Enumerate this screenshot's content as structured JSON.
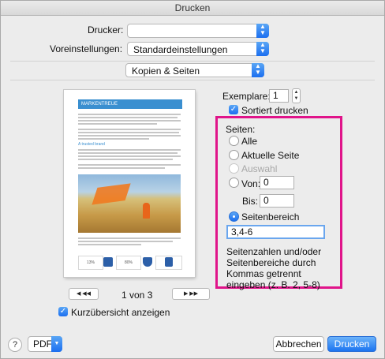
{
  "window": {
    "title": "Drucken"
  },
  "printer": {
    "label": "Drucker:",
    "value": ""
  },
  "presets": {
    "label": "Voreinstellungen:",
    "value": "Standardeinstellungen"
  },
  "section_menu": {
    "value": "Kopien & Seiten"
  },
  "copies": {
    "label": "Exemplare:",
    "value": "1",
    "collate_label": "Sortiert drucken",
    "collate_checked": true
  },
  "pages": {
    "heading": "Seiten:",
    "options": [
      "Alle",
      "Aktuelle Seite",
      "Auswahl",
      "Von:",
      "Seitenbereich"
    ],
    "from_value": "0",
    "to_label": "Bis:",
    "to_value": "0",
    "range_value": "3,4-6",
    "hint": "Seitenzahlen und/oder Seitenbereiche durch Kommas getrennt eingeben (z. B. 2, 5-8)"
  },
  "preview": {
    "doc_title": "MARKENTREUE",
    "subheading": "A trusted brand",
    "page_indicator": "1 von 3",
    "stat1": "13%",
    "stat2": "80%",
    "prev_label": "◀ ◀◀",
    "next_label": "▶ ▶▶"
  },
  "thumbnails": {
    "label": "Kurzübersicht anzeigen",
    "checked": true
  },
  "footer": {
    "pdf_label": "PDF",
    "cancel_label": "Abbrechen",
    "print_label": "Drucken"
  },
  "colors": {
    "accent": "#1c74f0",
    "highlight": "#e0148a",
    "doc_header": "#3a8fd0"
  }
}
